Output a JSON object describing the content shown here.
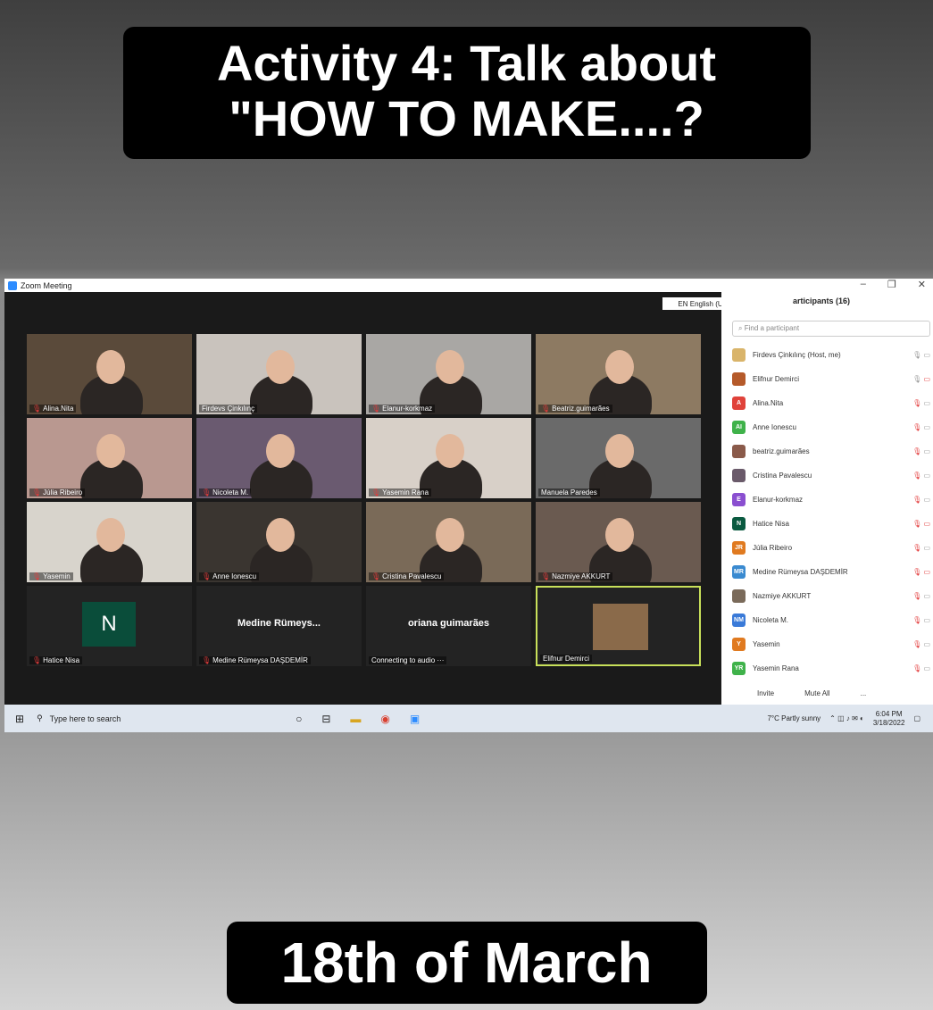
{
  "banner_top": {
    "line1": "Activity 4: Talk about",
    "line2": "\"HOW TO MAKE....?"
  },
  "banner_bottom": "18th of March",
  "window": {
    "title": "Zoom Meeting",
    "language": "EN English (United States)"
  },
  "tiles": [
    {
      "name": "Alina.Nita",
      "muted": true
    },
    {
      "name": "Firdevs Çinkılınç",
      "muted": false
    },
    {
      "name": "Elanur-korkmaz",
      "muted": true
    },
    {
      "name": "Beatriz.guimarães",
      "muted": true
    },
    {
      "name": "Júlia Ribeiro",
      "muted": true
    },
    {
      "name": "Nicoleta M.",
      "muted": true
    },
    {
      "name": "Yasemin Rana",
      "muted": true
    },
    {
      "name": "Manuela Paredes",
      "muted": false
    },
    {
      "name": "Yasemin",
      "muted": true
    },
    {
      "name": "Anne Ionescu",
      "muted": true
    },
    {
      "name": "Cristina Pavalescu",
      "muted": true
    },
    {
      "name": "Nazmiye AKKURT",
      "muted": true
    },
    {
      "name": "Hatice Nisa",
      "muted": true,
      "avatar": "N"
    },
    {
      "name": "Medine Rümeysa DAŞDEMİR",
      "muted": true,
      "big": "Medine Rümeys..."
    },
    {
      "name": "Connecting to audio ···",
      "muted": false,
      "big": "oriana guimarães"
    },
    {
      "name": "Elifnur Demirci",
      "muted": false
    }
  ],
  "participants": {
    "header": "articipants (16)",
    "search_placeholder": "Find a participant",
    "list": [
      {
        "initials": "",
        "name": "Firdevs Çinkılınç (Host, me)",
        "color": "#d9b46a",
        "mic": "on"
      },
      {
        "initials": "",
        "name": "Elifnur Demirci",
        "color": "#b55a2a",
        "mic": "on-videooff"
      },
      {
        "initials": "A",
        "name": "Alina.Nita",
        "color": "#e0423a",
        "mic": "off"
      },
      {
        "initials": "AI",
        "name": "Anne Ionescu",
        "color": "#3fb24a",
        "mic": "off"
      },
      {
        "initials": "",
        "name": "beatriz.guimarães",
        "color": "#8a5a4a",
        "mic": "off"
      },
      {
        "initials": "",
        "name": "Cristina Pavalescu",
        "color": "#6a5a6a",
        "mic": "off"
      },
      {
        "initials": "E",
        "name": "Elanur-korkmaz",
        "color": "#8a4fd0",
        "mic": "off"
      },
      {
        "initials": "N",
        "name": "Hatice Nisa",
        "color": "#0a5a40",
        "mic": "off-videooff"
      },
      {
        "initials": "JR",
        "name": "Júlia Ribeiro",
        "color": "#e07a20",
        "mic": "off"
      },
      {
        "initials": "MR",
        "name": "Medine Rümeysa DAŞDEMİR",
        "color": "#3a8ad0",
        "mic": "off-videooff"
      },
      {
        "initials": "",
        "name": "Nazmiye AKKURT",
        "color": "#7a6a5a",
        "mic": "off"
      },
      {
        "initials": "NM",
        "name": "Nicoleta M.",
        "color": "#3a7ad8",
        "mic": "off"
      },
      {
        "initials": "Y",
        "name": "Yasemin",
        "color": "#e07a20",
        "mic": "off"
      },
      {
        "initials": "YR",
        "name": "Yasemin Rana",
        "color": "#3fb24a",
        "mic": "off"
      }
    ],
    "footer": {
      "invite": "Invite",
      "mute_all": "Mute All",
      "more": "..."
    }
  },
  "taskbar": {
    "search_placeholder": "Type here to search",
    "weather": "7°C Partly sunny",
    "time": "6:04 PM",
    "date": "3/18/2022"
  }
}
